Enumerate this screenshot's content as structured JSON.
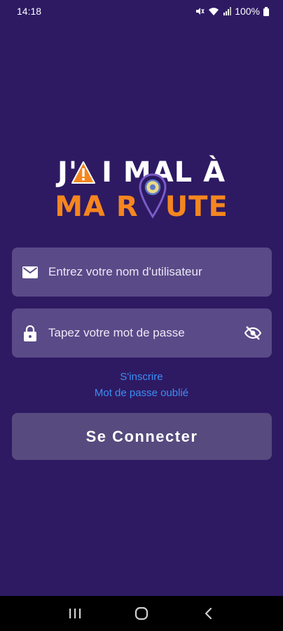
{
  "status_bar": {
    "time": "14:18",
    "battery": "100%",
    "icons": [
      "mute-icon",
      "wifi-icon",
      "signal-icon",
      "battery-icon"
    ]
  },
  "logo": {
    "line1_a": "J'",
    "line1_b": "I MAL À",
    "line2_a": "MA R",
    "line2_b": "UTE"
  },
  "login_form": {
    "username_placeholder": "Entrez votre nom d'utilisateur",
    "password_placeholder": "Tapez votre mot de passe"
  },
  "links": {
    "signup": "S'inscrire",
    "forgot_password": "Mot de passe oublié"
  },
  "submit_label": "Se Connecter",
  "colors": {
    "background": "#2e1a63",
    "input": "#5a4a88",
    "button": "#574a7e",
    "link": "#3d8ef5",
    "brand_orange": "#f5861f"
  },
  "nav_bar": {
    "icons": [
      "recent-apps-icon",
      "home-icon",
      "back-icon"
    ]
  }
}
